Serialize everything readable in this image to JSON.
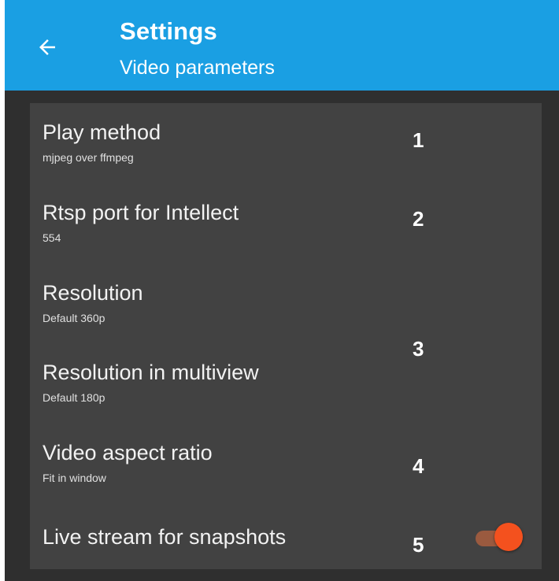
{
  "appbar": {
    "title": "Settings",
    "subtitle": "Video parameters",
    "back_icon": "arrow-left-icon",
    "color": "#1a9fe3"
  },
  "preferences": [
    {
      "title": "Play method",
      "summary": "mjpeg over ffmpeg"
    },
    {
      "title": "Rtsp port for Intellect",
      "summary": "554"
    },
    {
      "title": "Resolution",
      "summary": "Default 360p"
    },
    {
      "title": "Resolution in multiview",
      "summary": "Default 180p"
    },
    {
      "title": "Video aspect ratio",
      "summary": "Fit in window"
    },
    {
      "title": "Live stream for snapshots",
      "switch_on": true,
      "switch_color": "#f4511e"
    }
  ],
  "markers": [
    "1",
    "2",
    "3",
    "4",
    "5"
  ],
  "colors": {
    "background": "#2f2f2f",
    "card": "#424242",
    "accent": "#f4511e"
  }
}
